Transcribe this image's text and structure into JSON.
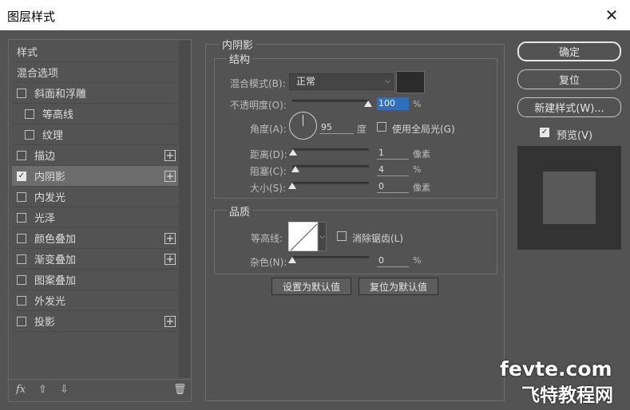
{
  "window": {
    "title": "图层样式",
    "close_glyph": "✕"
  },
  "sidebar": {
    "header": "样式",
    "blend_options": "混合选项",
    "items": [
      {
        "label": "斜面和浮雕",
        "checked": false,
        "plus": false
      },
      {
        "label": "等高线",
        "checked": false,
        "plus": false
      },
      {
        "label": "纹理",
        "checked": false,
        "plus": false
      },
      {
        "label": "描边",
        "checked": false,
        "plus": true
      },
      {
        "label": "内阴影",
        "checked": true,
        "plus": true
      },
      {
        "label": "内发光",
        "checked": false,
        "plus": false
      },
      {
        "label": "光泽",
        "checked": false,
        "plus": false
      },
      {
        "label": "颜色叠加",
        "checked": false,
        "plus": true
      },
      {
        "label": "渐变叠加",
        "checked": false,
        "plus": true
      },
      {
        "label": "图案叠加",
        "checked": false,
        "plus": false
      },
      {
        "label": "外发光",
        "checked": false,
        "plus": false
      },
      {
        "label": "投影",
        "checked": false,
        "plus": true
      }
    ],
    "bottom": {
      "fx": "fx",
      "up": "⇧",
      "down": "⇩",
      "trash": "🗑"
    }
  },
  "inner_shadow": {
    "section_title": "内阴影",
    "structure": {
      "title": "结构",
      "blend_mode_label": "混合模式(B):",
      "blend_mode_value": "正常",
      "shadow_color": "#2b2b2b",
      "opacity_label": "不透明度(O):",
      "opacity_value": "100",
      "opacity_unit": "%",
      "angle_label": "角度(A):",
      "angle_value": "95",
      "angle_unit": "度",
      "global_light_label": "使用全局光(G)",
      "global_light_checked": false,
      "distance_label": "距离(D):",
      "distance_value": "1",
      "distance_unit": "像素",
      "choke_label": "阻塞(C):",
      "choke_value": "4",
      "choke_unit": "%",
      "size_label": "大小(S):",
      "size_value": "0",
      "size_unit": "像素"
    },
    "quality": {
      "title": "品质",
      "contour_label": "等高线:",
      "anti_alias_label": "消除锯齿(L)",
      "anti_alias_checked": false,
      "noise_label": "杂色(N):",
      "noise_value": "0",
      "noise_unit": "%"
    },
    "buttons": {
      "make_default": "设置为默认值",
      "reset_default": "复位为默认值"
    }
  },
  "right": {
    "ok": "确定",
    "reset": "复位",
    "new_style": "新建样式(W)...",
    "preview_label": "预览(V)",
    "preview_checked": true
  },
  "watermark": {
    "line1": "fevte.com",
    "line2": "飞特教程网"
  }
}
